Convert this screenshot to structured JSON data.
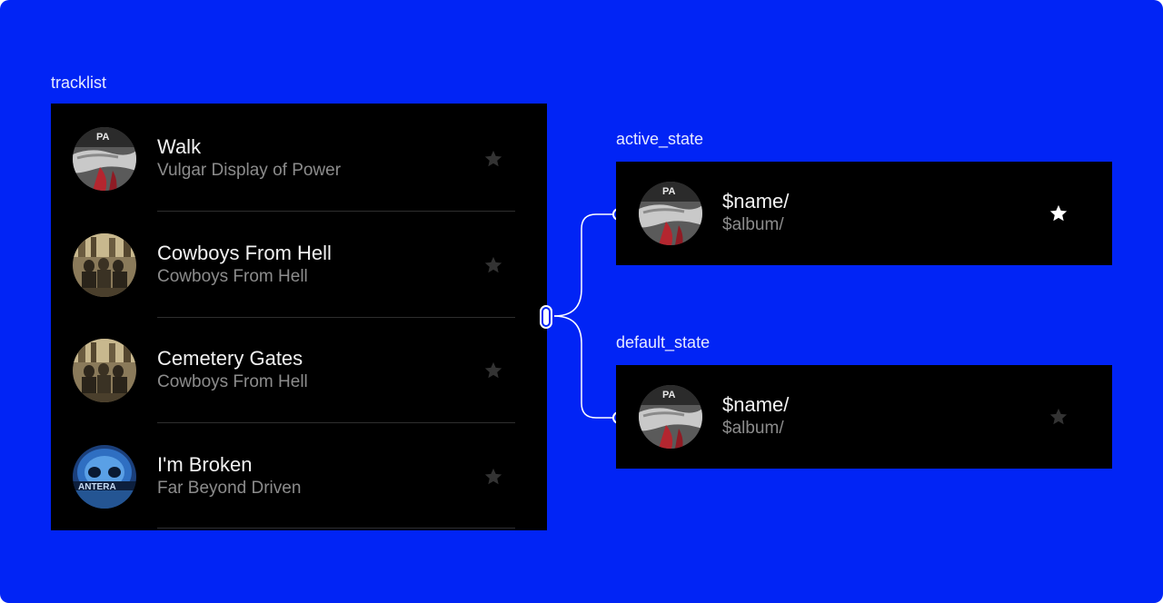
{
  "labels": {
    "tracklist": "tracklist",
    "active_state": "active_state",
    "default_state": "default_state"
  },
  "tracks": [
    {
      "name": "Walk",
      "album": "Vulgar Display of Power",
      "cover": "fist-cover-icon",
      "starred": false
    },
    {
      "name": "Cowboys From Hell",
      "album": "Cowboys From Hell",
      "cover": "band-photo-cover-icon",
      "starred": false
    },
    {
      "name": "Cemetery Gates",
      "album": "Cowboys From Hell",
      "cover": "band-photo-cover-icon",
      "starred": false
    },
    {
      "name": "I'm Broken",
      "album": "Far Beyond Driven",
      "cover": "skull-cover-icon",
      "starred": false
    }
  ],
  "active_state": {
    "name": "$name/",
    "album": "$album/",
    "starred": true
  },
  "default_state": {
    "name": "$name/",
    "album": "$album/",
    "starred": false
  },
  "colors": {
    "background": "#0124F5",
    "card": "#000000",
    "title_text": "#F2F2F2",
    "subtitle_text": "#8C8C8C",
    "star_active": "#FFFFFF",
    "star_inactive": "#333333",
    "connector": "#FFFFFF"
  }
}
